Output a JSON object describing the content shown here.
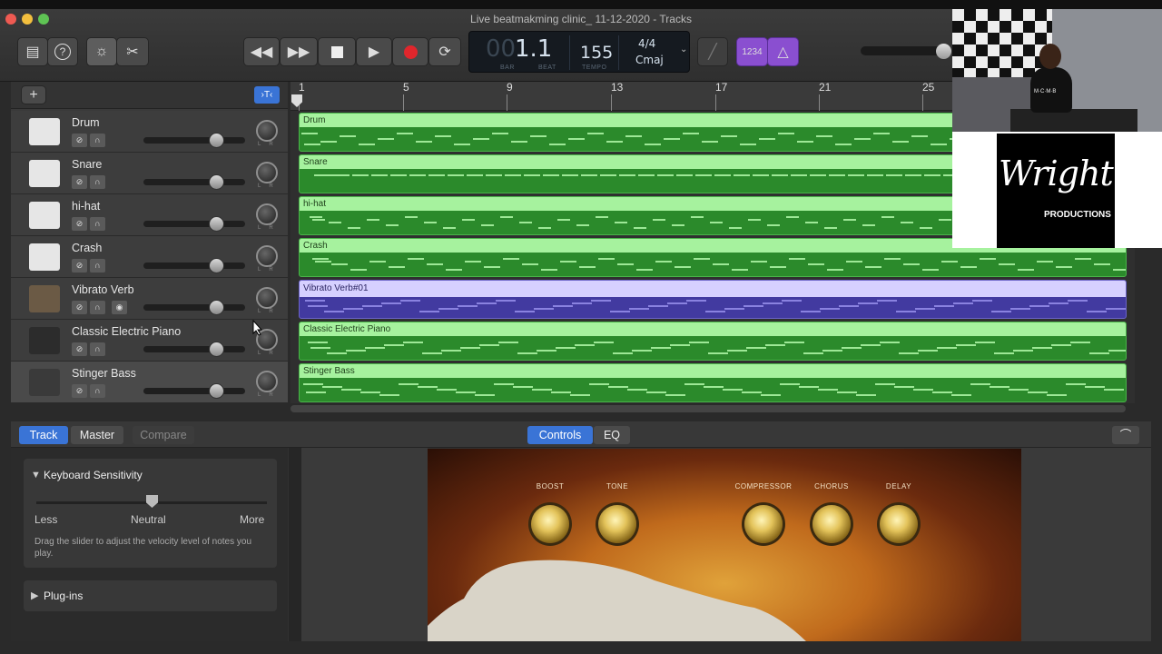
{
  "window": {
    "title": "Live beatmakming clinic_ 11-12-2020 - Tracks"
  },
  "toolbar": {
    "library_icon": "library-icon",
    "help_label": "?",
    "lcd": {
      "bar": "00",
      "beat_big": "1.1",
      "bar_label": "BAR",
      "beat_label": "BEAT",
      "tempo": "155",
      "tempo_label": "TEMPO",
      "signature": "4/4",
      "key": "Cmaj"
    },
    "count_in": "1234"
  },
  "tracks": [
    {
      "name": "Drum",
      "region": "Drum",
      "type": "drum"
    },
    {
      "name": "Snare",
      "region": "Snare",
      "type": "drum"
    },
    {
      "name": "hi-hat",
      "region": "hi-hat",
      "type": "drum"
    },
    {
      "name": "Crash",
      "region": "Crash",
      "type": "drum"
    },
    {
      "name": "Vibrato Verb",
      "region": "Vibrato Verb#01",
      "type": "amp"
    },
    {
      "name": "Classic Electric Piano",
      "region": "Classic Electric Piano",
      "type": "piano"
    },
    {
      "name": "Stinger Bass",
      "region": "Stinger Bass",
      "type": "bass"
    }
  ],
  "ruler": [
    "1",
    "5",
    "9",
    "13",
    "17",
    "21",
    "25"
  ],
  "smart_controls": {
    "tabs": {
      "track": "Track",
      "master": "Master",
      "compare": "Compare",
      "controls": "Controls",
      "eq": "EQ"
    },
    "keyboard_sensitivity": {
      "title": "Keyboard Sensitivity",
      "less": "Less",
      "neutral": "Neutral",
      "more": "More",
      "help": "Drag the slider to adjust the velocity level of notes you play.",
      "value": 0.5
    },
    "plugins_label": "Plug-ins",
    "amp_knobs": [
      "BOOST",
      "TONE",
      "COMPRESSOR",
      "CHORUS",
      "DELAY"
    ]
  },
  "overlay": {
    "logo_main": "Wright",
    "logo_sub": "PRODUCTIONS",
    "shirt": "M·C·M·B"
  },
  "colors": {
    "region_green": "#2b8a2b",
    "region_header": "#a6f29e",
    "region_purple": "#423aa0",
    "accent_blue": "#3a74d6",
    "count_in_purple": "#8a4fd0"
  }
}
